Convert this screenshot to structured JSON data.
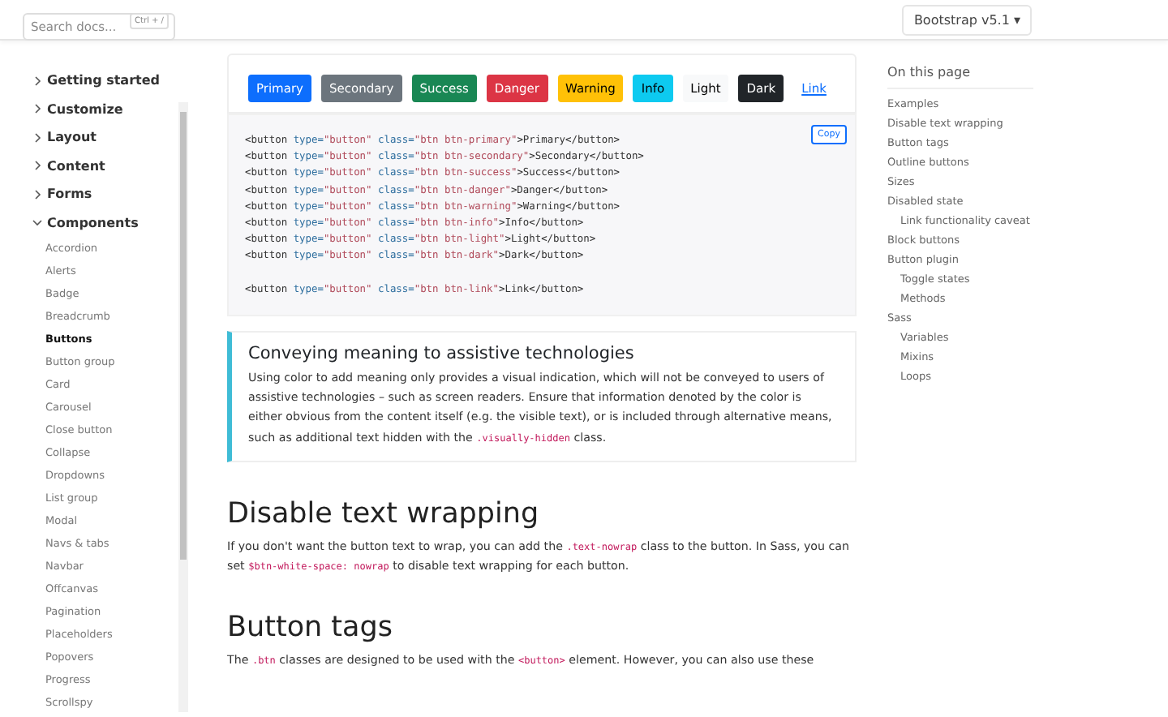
{
  "search": {
    "placeholder": "Search docs...",
    "shortcut": "Ctrl + /"
  },
  "version_menu": {
    "label": "Bootstrap v5.1",
    "caret": "▾"
  },
  "sidebar": {
    "groups": [
      {
        "label": "Getting started",
        "expanded": false
      },
      {
        "label": "Customize",
        "expanded": false
      },
      {
        "label": "Layout",
        "expanded": false
      },
      {
        "label": "Content",
        "expanded": false
      },
      {
        "label": "Forms",
        "expanded": false
      },
      {
        "label": "Components",
        "expanded": true,
        "items": [
          {
            "label": "Accordion",
            "selected": false
          },
          {
            "label": "Alerts",
            "selected": false
          },
          {
            "label": "Badge",
            "selected": false
          },
          {
            "label": "Breadcrumb",
            "selected": false
          },
          {
            "label": "Buttons",
            "selected": true
          },
          {
            "label": "Button group",
            "selected": false
          },
          {
            "label": "Card",
            "selected": false
          },
          {
            "label": "Carousel",
            "selected": false
          },
          {
            "label": "Close button",
            "selected": false
          },
          {
            "label": "Collapse",
            "selected": false
          },
          {
            "label": "Dropdowns",
            "selected": false
          },
          {
            "label": "List group",
            "selected": false
          },
          {
            "label": "Modal",
            "selected": false
          },
          {
            "label": "Navs & tabs",
            "selected": false
          },
          {
            "label": "Navbar",
            "selected": false
          },
          {
            "label": "Offcanvas",
            "selected": false
          },
          {
            "label": "Pagination",
            "selected": false
          },
          {
            "label": "Placeholders",
            "selected": false
          },
          {
            "label": "Popovers",
            "selected": false
          },
          {
            "label": "Progress",
            "selected": false
          },
          {
            "label": "Scrollspy",
            "selected": false
          }
        ]
      }
    ]
  },
  "demo_buttons": [
    {
      "label": "Primary",
      "kind": "primary"
    },
    {
      "label": "Secondary",
      "kind": "secondary"
    },
    {
      "label": "Success",
      "kind": "success"
    },
    {
      "label": "Danger",
      "kind": "danger"
    },
    {
      "label": "Warning",
      "kind": "warning"
    },
    {
      "label": "Info",
      "kind": "info"
    },
    {
      "label": "Light",
      "kind": "light"
    },
    {
      "label": "Dark",
      "kind": "dark"
    },
    {
      "label": "Link",
      "kind": "link"
    }
  ],
  "code": {
    "copy_label": "Copy",
    "blocks": [
      [
        [
          {
            "kind": "tag",
            "text": "<button "
          },
          {
            "kind": "attr",
            "text": "type="
          },
          {
            "kind": "str",
            "text": "\"button\""
          },
          {
            "kind": "attr",
            "text": " class="
          },
          {
            "kind": "str",
            "text": "\"btn btn-primary\""
          },
          {
            "kind": "tag",
            "text": ">Primary</button>"
          }
        ],
        [
          {
            "kind": "tag",
            "text": "<button "
          },
          {
            "kind": "attr",
            "text": "type="
          },
          {
            "kind": "str",
            "text": "\"button\""
          },
          {
            "kind": "attr",
            "text": " class="
          },
          {
            "kind": "str",
            "text": "\"btn btn-secondary\""
          },
          {
            "kind": "tag",
            "text": ">Secondary</button>"
          }
        ],
        [
          {
            "kind": "tag",
            "text": "<button "
          },
          {
            "kind": "attr",
            "text": "type="
          },
          {
            "kind": "str",
            "text": "\"button\""
          },
          {
            "kind": "attr",
            "text": " class="
          },
          {
            "kind": "str",
            "text": "\"btn btn-success\""
          },
          {
            "kind": "tag",
            "text": ">Success</button>"
          }
        ],
        [
          {
            "kind": "tag",
            "text": "<button "
          },
          {
            "kind": "attr",
            "text": "type="
          },
          {
            "kind": "str",
            "text": "\"button\""
          },
          {
            "kind": "attr",
            "text": " class="
          },
          {
            "kind": "str",
            "text": "\"btn btn-danger\""
          },
          {
            "kind": "tag",
            "text": ">Danger</button>"
          }
        ],
        [
          {
            "kind": "tag",
            "text": "<button "
          },
          {
            "kind": "attr",
            "text": "type="
          },
          {
            "kind": "str",
            "text": "\"button\""
          },
          {
            "kind": "attr",
            "text": " class="
          },
          {
            "kind": "str",
            "text": "\"btn btn-warning\""
          },
          {
            "kind": "tag",
            "text": ">Warning</button>"
          }
        ],
        [
          {
            "kind": "tag",
            "text": "<button "
          },
          {
            "kind": "attr",
            "text": "type="
          },
          {
            "kind": "str",
            "text": "\"button\""
          },
          {
            "kind": "attr",
            "text": " class="
          },
          {
            "kind": "str",
            "text": "\"btn btn-info\""
          },
          {
            "kind": "tag",
            "text": ">Info</button>"
          }
        ],
        [
          {
            "kind": "tag",
            "text": "<button "
          },
          {
            "kind": "attr",
            "text": "type="
          },
          {
            "kind": "str",
            "text": "\"button\""
          },
          {
            "kind": "attr",
            "text": " class="
          },
          {
            "kind": "str",
            "text": "\"btn btn-light\""
          },
          {
            "kind": "tag",
            "text": ">Light</button>"
          }
        ],
        [
          {
            "kind": "tag",
            "text": "<button "
          },
          {
            "kind": "attr",
            "text": "type="
          },
          {
            "kind": "str",
            "text": "\"button\""
          },
          {
            "kind": "attr",
            "text": " class="
          },
          {
            "kind": "str",
            "text": "\"btn btn-dark\""
          },
          {
            "kind": "tag",
            "text": ">Dark</button>"
          }
        ]
      ],
      [
        [
          {
            "kind": "tag",
            "text": "<button "
          },
          {
            "kind": "attr",
            "text": "type="
          },
          {
            "kind": "str",
            "text": "\"button\""
          },
          {
            "kind": "attr",
            "text": " class="
          },
          {
            "kind": "str",
            "text": "\"btn btn-link\""
          },
          {
            "kind": "tag",
            "text": ">Link</button>"
          }
        ]
      ]
    ]
  },
  "callout": {
    "title": "Conveying meaning to assistive technologies",
    "body": [
      {
        "kind": "text",
        "text": "Using color to add meaning only provides a visual indication, which will not be conveyed to users of assistive technologies – such as screen readers. Ensure that information denoted by the color is either obvious from the content itself (e.g. the visible text), or is included through alternative means, such as additional text hidden with the "
      },
      {
        "kind": "code",
        "text": ".visually-hidden"
      },
      {
        "kind": "text",
        "text": " class."
      }
    ]
  },
  "sections": [
    {
      "heading": "Disable text wrapping",
      "body": [
        {
          "kind": "text",
          "text": "If you don't want the button text to wrap, you can add the "
        },
        {
          "kind": "code",
          "text": ".text-nowrap"
        },
        {
          "kind": "text",
          "text": " class to the button. In Sass, you can set "
        },
        {
          "kind": "code",
          "text": "$btn-white-space: nowrap"
        },
        {
          "kind": "text",
          "text": " to disable text wrapping for each button."
        }
      ]
    },
    {
      "heading": "Button tags",
      "body": [
        {
          "kind": "text",
          "text": "The "
        },
        {
          "kind": "code",
          "text": ".btn"
        },
        {
          "kind": "text",
          "text": " classes are designed to be used with the "
        },
        {
          "kind": "code",
          "text": "<button>"
        },
        {
          "kind": "text",
          "text": " element. However, you can also use these"
        }
      ]
    }
  ],
  "toc": {
    "title": "On this page",
    "items": [
      {
        "label": "Examples"
      },
      {
        "label": "Disable text wrapping"
      },
      {
        "label": "Button tags"
      },
      {
        "label": "Outline buttons"
      },
      {
        "label": "Sizes"
      },
      {
        "label": "Disabled state",
        "children": [
          {
            "label": "Link functionality caveat"
          }
        ]
      },
      {
        "label": "Block buttons"
      },
      {
        "label": "Button plugin",
        "children": [
          {
            "label": "Toggle states"
          },
          {
            "label": "Methods"
          }
        ]
      },
      {
        "label": "Sass",
        "children": [
          {
            "label": "Variables"
          },
          {
            "label": "Mixins"
          },
          {
            "label": "Loops"
          }
        ]
      }
    ]
  }
}
